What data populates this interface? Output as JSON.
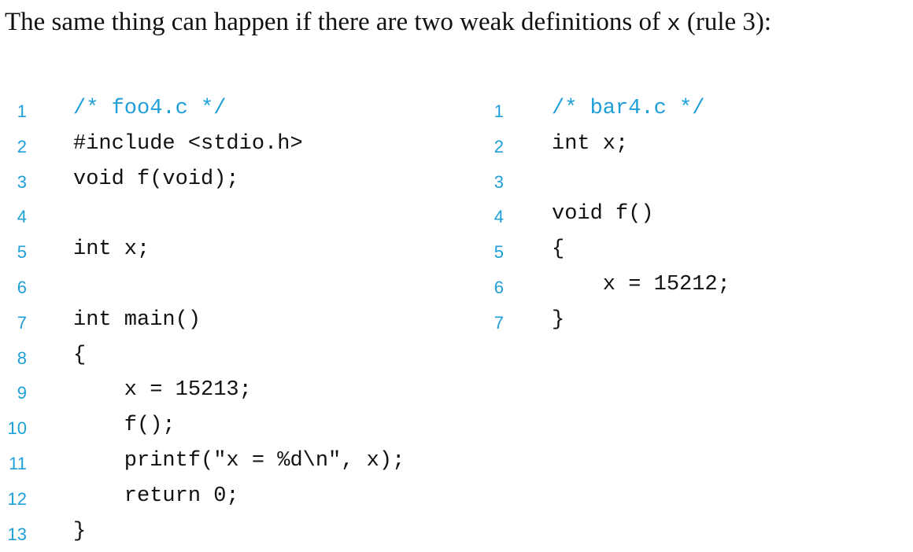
{
  "intro": {
    "before": "The same thing can happen if there are two weak definitions of ",
    "code": "x",
    "after": " (rule 3):"
  },
  "listings": [
    {
      "name": "foo4",
      "lines": [
        {
          "num": "1",
          "text": "/* foo4.c */",
          "comment": true
        },
        {
          "num": "2",
          "text": "#include <stdio.h>",
          "comment": false
        },
        {
          "num": "3",
          "text": "void f(void);",
          "comment": false
        },
        {
          "num": "4",
          "text": "",
          "comment": false
        },
        {
          "num": "5",
          "text": "int x;",
          "comment": false
        },
        {
          "num": "6",
          "text": "",
          "comment": false
        },
        {
          "num": "7",
          "text": "int main()",
          "comment": false
        },
        {
          "num": "8",
          "text": "{",
          "comment": false
        },
        {
          "num": "9",
          "text": "    x = 15213;",
          "comment": false
        },
        {
          "num": "10",
          "text": "    f();",
          "comment": false
        },
        {
          "num": "11",
          "text": "    printf(\"x = %d\\n\", x);",
          "comment": false
        },
        {
          "num": "12",
          "text": "    return 0;",
          "comment": false
        },
        {
          "num": "13",
          "text": "}",
          "comment": false
        }
      ]
    },
    {
      "name": "bar4",
      "lines": [
        {
          "num": "1",
          "text": "/* bar4.c */",
          "comment": true
        },
        {
          "num": "2",
          "text": "int x;",
          "comment": false
        },
        {
          "num": "3",
          "text": "",
          "comment": false
        },
        {
          "num": "4",
          "text": "void f()",
          "comment": false
        },
        {
          "num": "5",
          "text": "{",
          "comment": false
        },
        {
          "num": "6",
          "text": "    x = 15212;",
          "comment": false
        },
        {
          "num": "7",
          "text": "}",
          "comment": false
        }
      ]
    }
  ],
  "colors": {
    "line_number": "#1e9fd8",
    "comment": "#1e9fd8",
    "text": "#111111"
  }
}
